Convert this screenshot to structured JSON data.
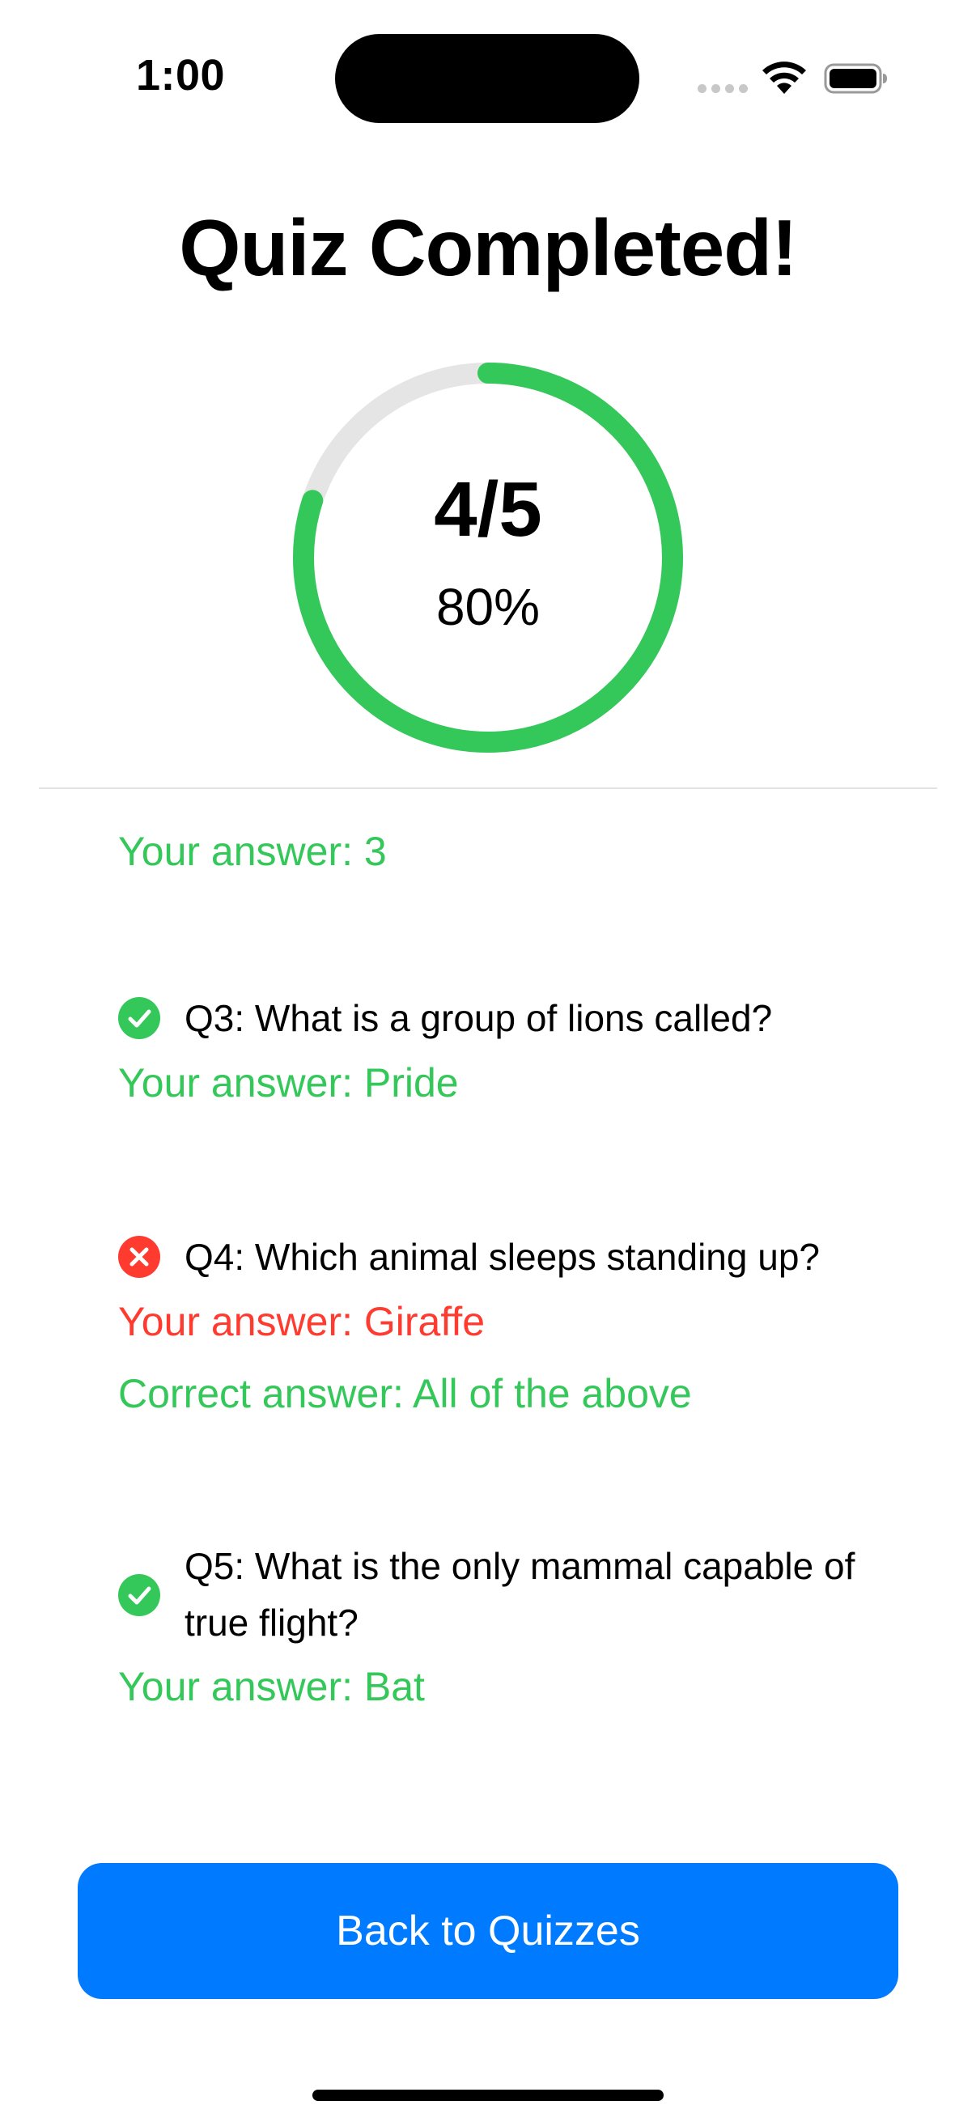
{
  "status_bar": {
    "time": "1:00"
  },
  "header": {
    "title": "Quiz Completed!"
  },
  "score": {
    "fraction": "4/5",
    "percent_label": "80%",
    "progress": 0.8,
    "ring_color": "#34c759",
    "track_color": "#e5e5e5"
  },
  "results": {
    "partial_answer": "Your answer: 3",
    "items": [
      {
        "question": "Q3: What is a group of lions called?",
        "status": "correct",
        "status_icon": "checkmark-circle-icon",
        "your_answer": "Your answer: Pride"
      },
      {
        "question": "Q4: Which animal sleeps standing up?",
        "status": "incorrect",
        "status_icon": "x-circle-icon",
        "your_answer": "Your answer: Giraffe",
        "correct_answer": "Correct answer: All of the above"
      },
      {
        "question_line1": "Q5: What is the only mammal capable of",
        "question_line2": "true flight?",
        "status": "correct",
        "status_icon": "checkmark-circle-icon",
        "your_answer": "Your answer: Bat"
      }
    ]
  },
  "actions": {
    "back_label": "Back to Quizzes"
  },
  "colors": {
    "correct": "#34c759",
    "incorrect": "#ff3b30",
    "accent": "#007aff"
  }
}
